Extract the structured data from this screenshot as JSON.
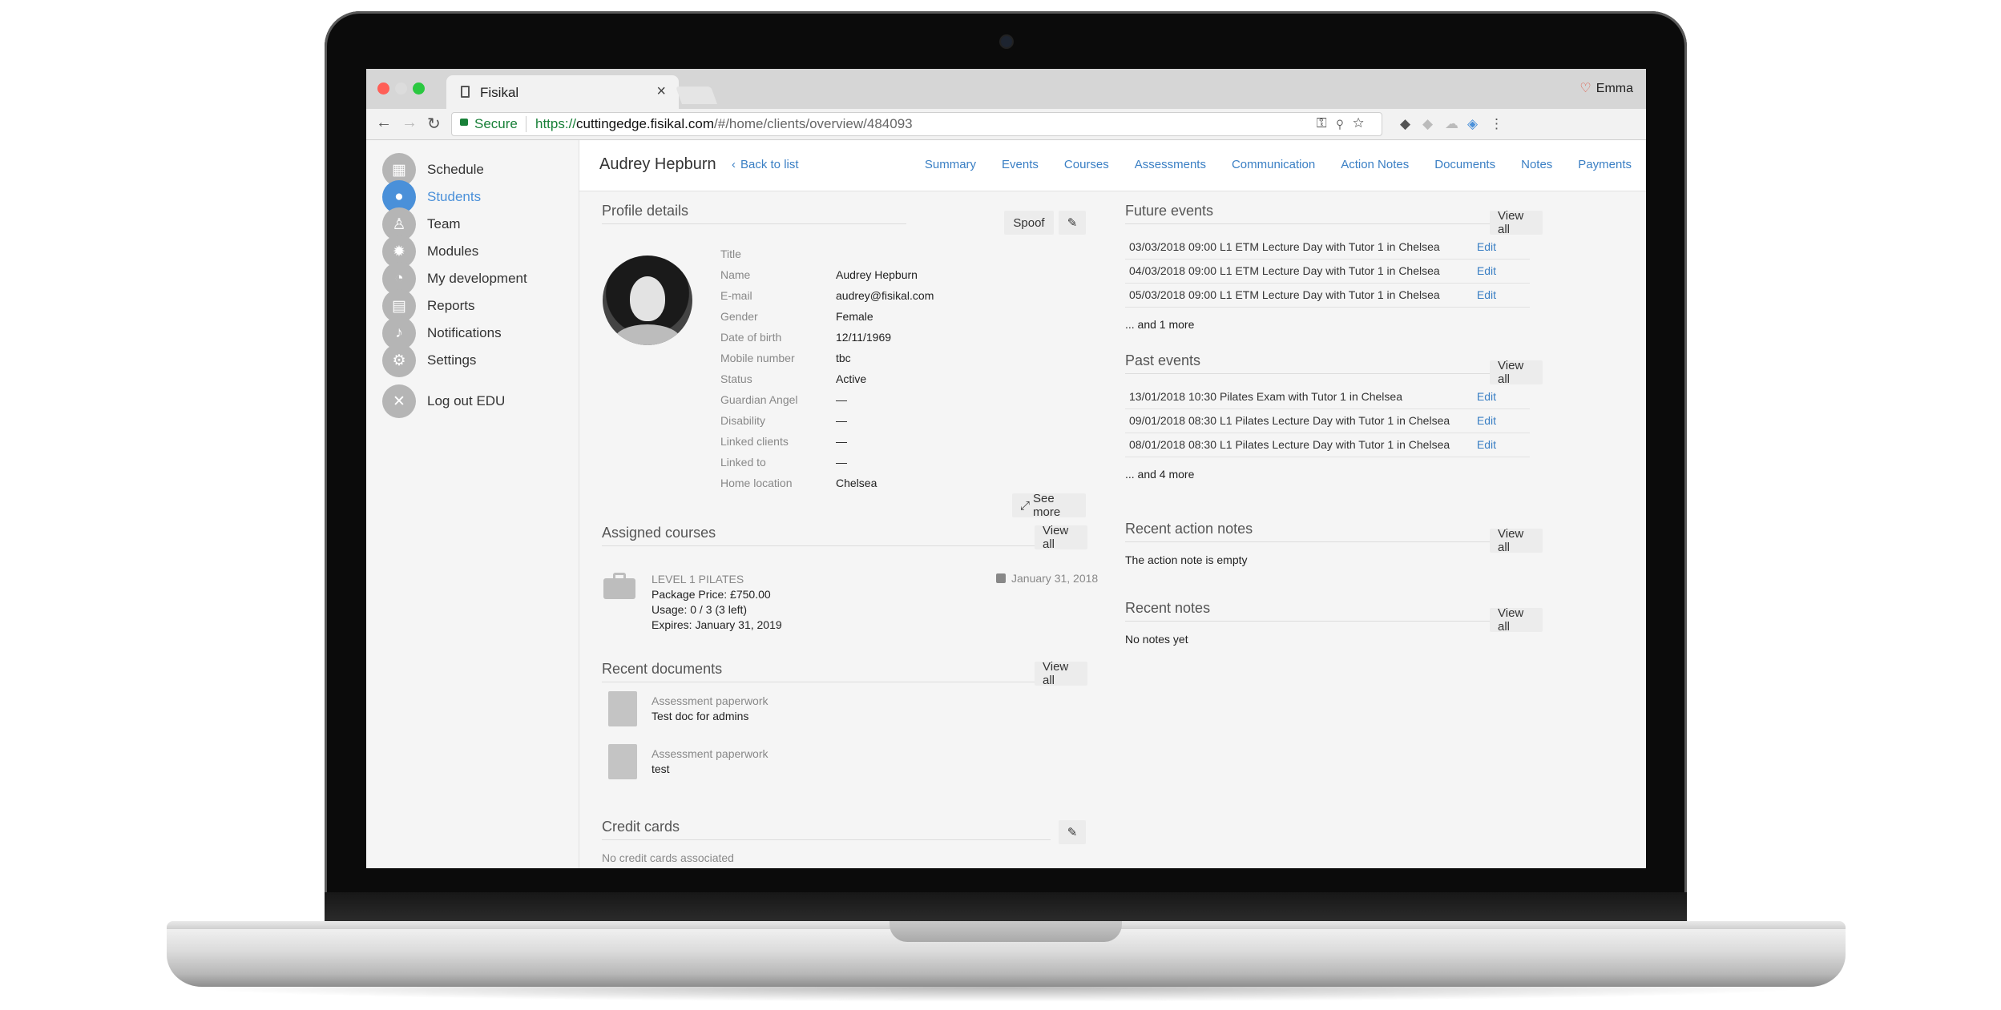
{
  "browser": {
    "tab_title": "Fisikal",
    "profile_name": "Emma",
    "secure_label": "Secure",
    "url_scheme": "https://",
    "url_host": "cuttingedge.fisikal.com",
    "url_path": "/#/home/clients/overview/484093"
  },
  "sidebar": {
    "items": [
      {
        "label": "Schedule",
        "icon": "calendar-icon"
      },
      {
        "label": "Students",
        "icon": "users-icon",
        "active": true
      },
      {
        "label": "Team",
        "icon": "person-icon"
      },
      {
        "label": "Modules",
        "icon": "gear-icon"
      },
      {
        "label": "My development",
        "icon": "dashboard-icon"
      },
      {
        "label": "Reports",
        "icon": "reports-icon"
      },
      {
        "label": "Notifications",
        "icon": "bell-icon"
      },
      {
        "label": "Settings",
        "icon": "settings-icon"
      }
    ],
    "logout_label": "Log out EDU"
  },
  "header": {
    "client_name": "Audrey Hepburn",
    "back_label": "Back to list",
    "tabs": [
      "Summary",
      "Events",
      "Courses",
      "Assessments",
      "Communication",
      "Action Notes",
      "Documents",
      "Notes",
      "Payments"
    ]
  },
  "profile": {
    "title": "Profile details",
    "spoof_label": "Spoof",
    "see_more_label": "See more",
    "fields": [
      {
        "label": "Title",
        "value": ""
      },
      {
        "label": "Name",
        "value": "Audrey Hepburn"
      },
      {
        "label": "E-mail",
        "value": "audrey@fisikal.com"
      },
      {
        "label": "Gender",
        "value": "Female"
      },
      {
        "label": "Date of birth",
        "value": "12/11/1969"
      },
      {
        "label": "Mobile number",
        "value": "tbc"
      },
      {
        "label": "Status",
        "value": "Active"
      },
      {
        "label": "Guardian Angel",
        "value": "—"
      },
      {
        "label": "Disability",
        "value": "—"
      },
      {
        "label": "Linked clients",
        "value": "—"
      },
      {
        "label": "Linked to",
        "value": "—"
      },
      {
        "label": "Home location",
        "value": "Chelsea"
      }
    ]
  },
  "courses": {
    "title": "Assigned courses",
    "view_all": "View all",
    "item": {
      "name": "LEVEL 1 PILATES",
      "price": "Package Price: £750.00",
      "usage": "Usage: 0 / 3 (3 left)",
      "expires": "Expires: January 31, 2019",
      "date": "January 31, 2018"
    }
  },
  "documents": {
    "title": "Recent documents",
    "view_all": "View all",
    "items": [
      {
        "type": "Assessment paperwork",
        "name": "Test doc for admins"
      },
      {
        "type": "Assessment paperwork",
        "name": "test"
      }
    ]
  },
  "credit_cards": {
    "title": "Credit cards",
    "empty": "No credit cards associated"
  },
  "future_events": {
    "title": "Future events",
    "view_all": "View all",
    "rows": [
      {
        "date": "03/03/2018 09:00",
        "title": "L1 ETM Lecture Day with Tutor 1 in Chelsea",
        "action": "Edit"
      },
      {
        "date": "04/03/2018 09:00",
        "title": "L1 ETM Lecture Day with Tutor 1 in Chelsea",
        "action": "Edit"
      },
      {
        "date": "05/03/2018 09:00",
        "title": "L1 ETM Lecture Day with Tutor 1 in Chelsea",
        "action": "Edit"
      }
    ],
    "more": "... and 1 more"
  },
  "past_events": {
    "title": "Past events",
    "view_all": "View all",
    "rows": [
      {
        "date": "13/01/2018 10:30",
        "title": "Pilates Exam with Tutor 1 in Chelsea",
        "action": "Edit"
      },
      {
        "date": "09/01/2018 08:30",
        "title": "L1 Pilates Lecture Day with Tutor 1 in Chelsea",
        "action": "Edit"
      },
      {
        "date": "08/01/2018 08:30",
        "title": "L1 Pilates Lecture Day with Tutor 1 in Chelsea",
        "action": "Edit"
      }
    ],
    "more": "... and 4 more"
  },
  "action_notes": {
    "title": "Recent action notes",
    "view_all": "View all",
    "empty": "The action note is empty"
  },
  "notes": {
    "title": "Recent notes",
    "view_all": "View all",
    "empty": "No notes yet"
  },
  "colors": {
    "accent": "#4a90d9",
    "link": "#3a7fc4",
    "secure": "#188038"
  }
}
